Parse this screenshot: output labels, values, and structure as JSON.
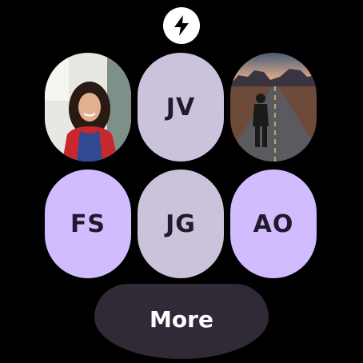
{
  "top_action": {
    "icon": "lightning-bolt-icon",
    "icon_color": "#000000",
    "background": "#ffffff"
  },
  "contacts": [
    {
      "initials": "",
      "type": "photo",
      "photo": "woman-smiling-photo"
    },
    {
      "initials": "JV",
      "type": "initials",
      "bg": "#cbc2db",
      "fg": "#1f1a2c"
    },
    {
      "initials": "",
      "type": "photo",
      "photo": "person-on-desert-road-photo"
    },
    {
      "initials": "FS",
      "type": "initials",
      "bg": "#d0bcff",
      "fg": "#1f1a2c"
    },
    {
      "initials": "JG",
      "type": "initials",
      "bg": "#cbc2db",
      "fg": "#1f1a2c"
    },
    {
      "initials": "AO",
      "type": "initials",
      "bg": "#d0bcff",
      "fg": "#1f1a2c"
    }
  ],
  "more_button": {
    "label": "More",
    "bg": "#2f2a36"
  }
}
